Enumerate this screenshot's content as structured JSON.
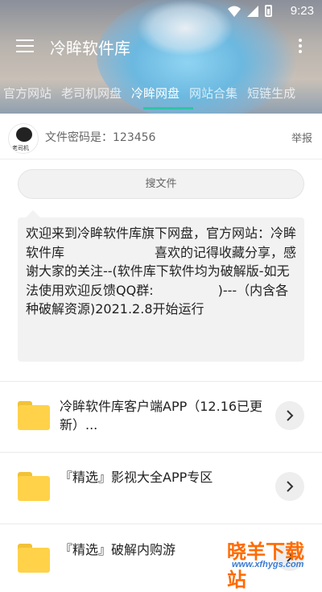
{
  "status_bar": {
    "time": "9:23"
  },
  "toolbar": {
    "title": "冷眸软件库"
  },
  "tabs": [
    {
      "label": "官方网站"
    },
    {
      "label": "老司机网盘"
    },
    {
      "label": "冷眸网盘",
      "active": true
    },
    {
      "label": "网站合集"
    },
    {
      "label": "短链生成"
    }
  ],
  "share": {
    "password_text": "文件密码是：123456",
    "report_label": "举报",
    "avatar_caption": "老司机"
  },
  "search": {
    "label": "搜文件"
  },
  "notice": {
    "text": "欢迎来到冷眸软件库旗下网盘，官方网站：冷眸软件库　　　　　　　喜欢的记得收藏分享，感谢大家的关注--(软件库下软件均为破解版-如无法使用欢迎反馈QQ群:　　　　　)---（内含各种破解资源)2021.2.8开始运行"
  },
  "files": [
    {
      "name": "冷眸软件库客户端APP（12.16已更新）..."
    },
    {
      "name": "『精选』影视大全APP专区"
    },
    {
      "name": "『精选』破解内购游"
    }
  ],
  "watermark": {
    "main": "晓羊下载站",
    "url": "www.xfhygs.com"
  },
  "colors": {
    "accent": "#2ec4a6",
    "folder": "#ffd24a",
    "watermark": "#ff6a00"
  }
}
